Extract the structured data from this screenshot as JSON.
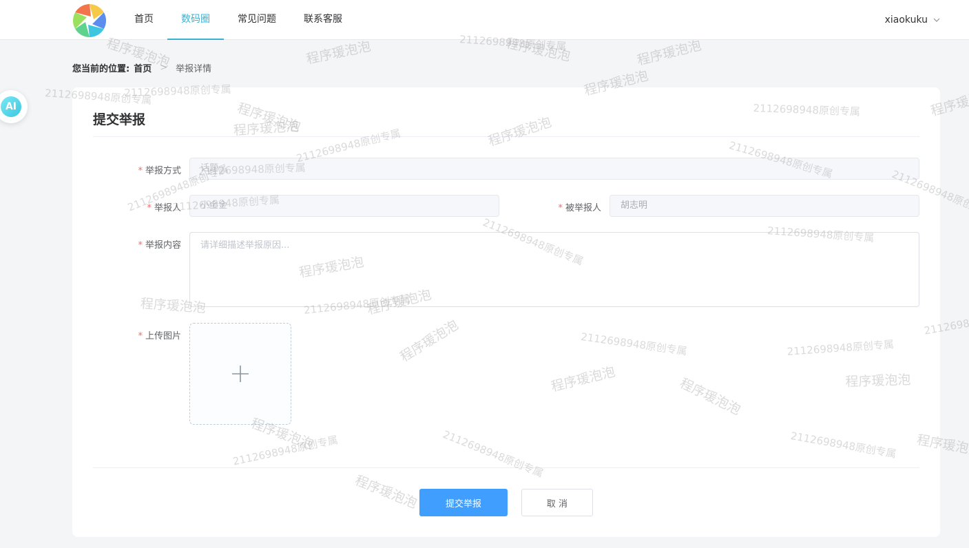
{
  "nav": {
    "items": [
      {
        "label": "首页",
        "active": false
      },
      {
        "label": "数码圈",
        "active": true
      },
      {
        "label": "常见问题",
        "active": false
      },
      {
        "label": "联系客服",
        "active": false
      }
    ],
    "user": "xiaokuku"
  },
  "breadcrumb": {
    "label": "您当前的位置:",
    "home": "首页",
    "current": "举报详情"
  },
  "ai_button": "AI",
  "form": {
    "title": "提交举报",
    "report_method": {
      "label": "举报方式",
      "value": "话题"
    },
    "reporter": {
      "label": "举报人",
      "value": "小金金"
    },
    "reported": {
      "label": "被举报人",
      "value": "胡志明"
    },
    "content": {
      "label": "举报内容",
      "placeholder": "请详细描述举报原因..."
    },
    "upload": {
      "label": "上传图片"
    },
    "submit_label": "提交举报",
    "cancel_label": "取 消"
  },
  "watermark": {
    "text_a": "程序瑗泡泡",
    "text_b": "2112698948原创专属"
  },
  "colors": {
    "accent": "#3bb1d0",
    "primary": "#409eff",
    "required": "#f56c6c"
  }
}
